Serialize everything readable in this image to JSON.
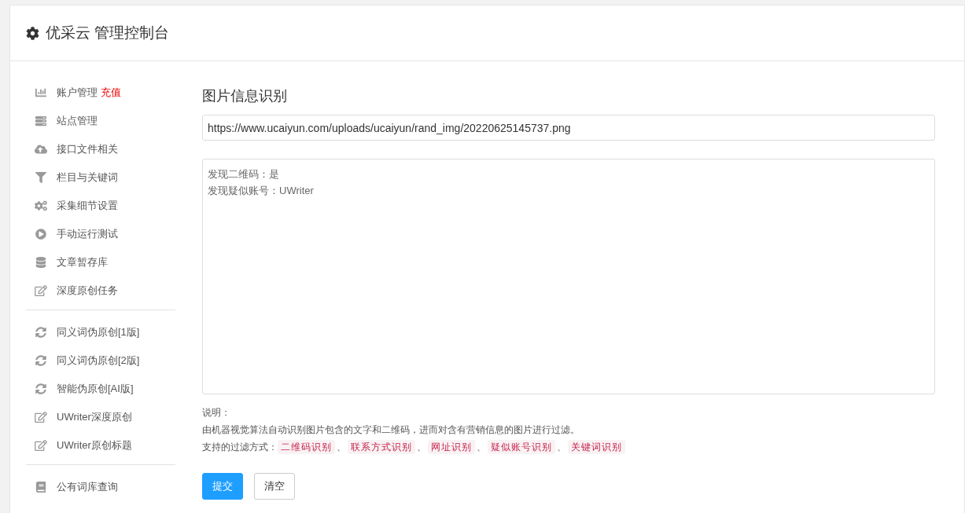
{
  "header": {
    "title": "优采云 管理控制台"
  },
  "sidebar": {
    "groups": [
      [
        {
          "label": "账户管理",
          "badge": "充值"
        },
        {
          "label": "站点管理"
        },
        {
          "label": "接口文件相关"
        },
        {
          "label": "栏目与关键词"
        },
        {
          "label": "采集细节设置"
        },
        {
          "label": "手动运行测试"
        },
        {
          "label": "文章暂存库"
        },
        {
          "label": "深度原创任务"
        }
      ],
      [
        {
          "label": "同义词伪原创[1版]"
        },
        {
          "label": "同义词伪原创[2版]"
        },
        {
          "label": "智能伪原创[AI版]"
        },
        {
          "label": "UWriter深度原创"
        },
        {
          "label": "UWriter原创标题"
        }
      ],
      [
        {
          "label": "公有词库查询"
        }
      ]
    ]
  },
  "main": {
    "title": "图片信息识别",
    "url": {
      "value": "https://www.ucaiyun.com/uploads/ucaiyun/rand_img/20220625145737.png"
    },
    "result": {
      "lines": [
        "发现二维码：是",
        "发现疑似账号：UWriter"
      ]
    },
    "note_label": "说明：",
    "note_text": "由机器视觉算法自动识别图片包含的文字和二维码，进而对含有营销信息的图片进行过滤。",
    "methods_label": "支持的过滤方式：",
    "separator": "、",
    "methods": [
      "二维码识别",
      "联系方式识别",
      "网址识别",
      "疑似账号识别",
      "关键词识别"
    ],
    "buttons": [
      {
        "label": "提交",
        "kind": "primary"
      },
      {
        "label": "清空",
        "kind": "default"
      }
    ]
  }
}
